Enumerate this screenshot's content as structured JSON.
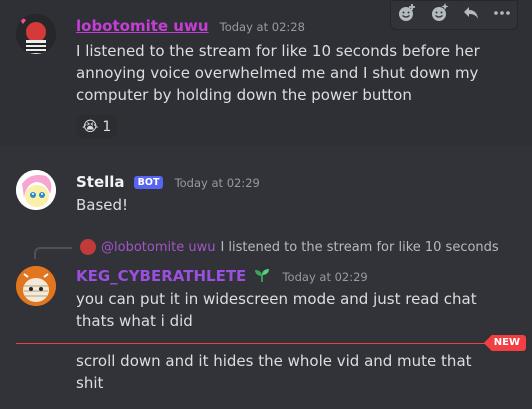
{
  "hover_toolbar": {
    "icons": [
      "add-reaction-icon",
      "super-reaction-icon",
      "reply-icon",
      "more-icon"
    ]
  },
  "messages": [
    {
      "username": "lobotomite uwu",
      "timestamp": "Today at 02:28",
      "lines": [
        "I listened to the stream for like 10 seconds before her",
        "annoying voice overwhelmed me and I shut down my",
        "computer by holding down the power button"
      ],
      "reaction": {
        "emoji": "😭",
        "count": "1"
      },
      "color": "#c73ed6"
    },
    {
      "username": "Stella",
      "bot_tag": "BOT",
      "timestamp": "Today at 02:29",
      "lines": [
        "Based!"
      ],
      "color": "#f2f3f5"
    },
    {
      "reply_to": {
        "username": "@lobotomite uwu",
        "preview": "I listened to the stream for like 10 seconds"
      },
      "username": "KEG_CYBERATHLETE",
      "timestamp": "Today at 02:29",
      "lines": [
        "you can put it in widescreen mode and just read chat",
        "thats what i did"
      ],
      "color": "#9b4fe0"
    },
    {
      "lines": [
        "scroll down and it hides the whole vid and mute that",
        "shit"
      ]
    }
  ],
  "new_badge": "NEW",
  "colors": {
    "background": "#313338",
    "new": "#f23f43",
    "bot": "#5865f2"
  }
}
